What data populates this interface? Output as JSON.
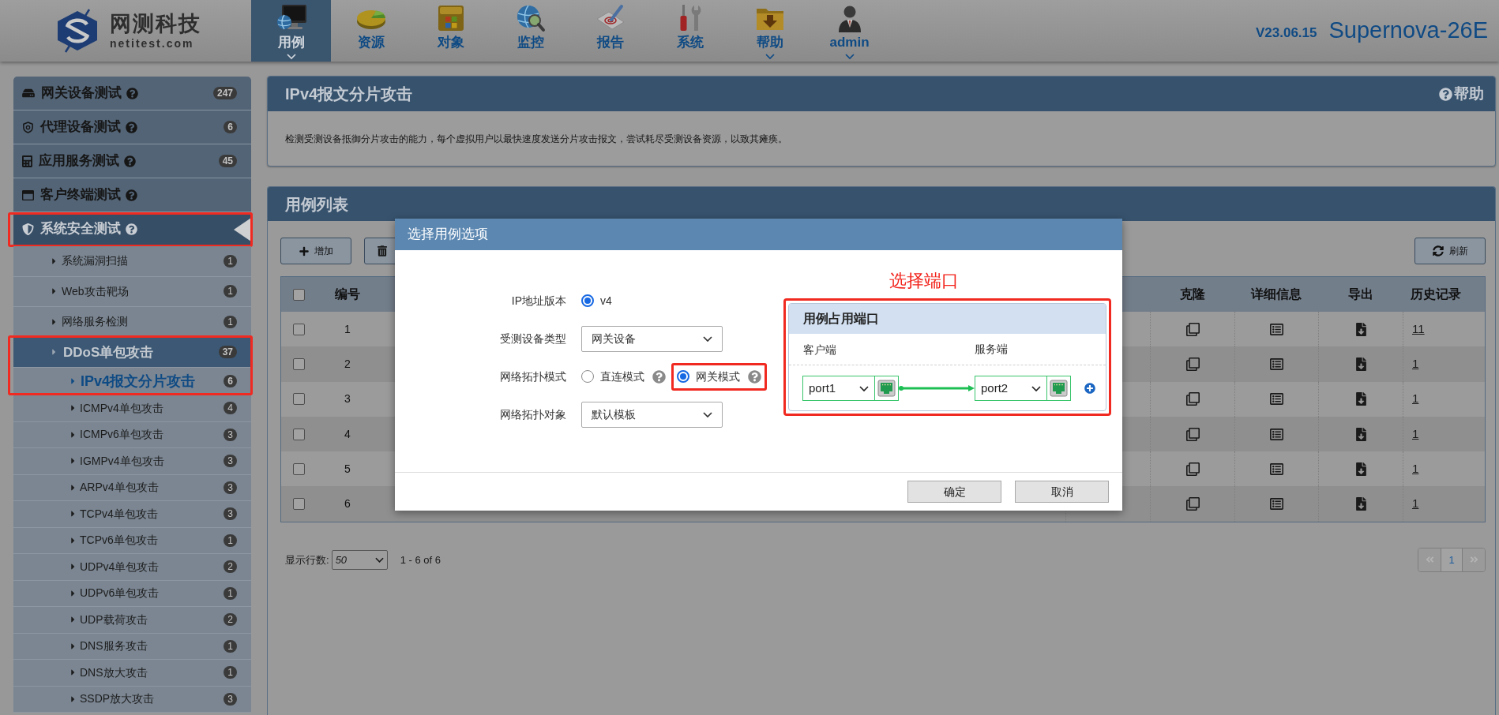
{
  "header": {
    "logo": {
      "name": "网测科技",
      "domain": "netitest.com"
    },
    "nav": [
      {
        "label": "用例",
        "selected": true,
        "dropdown": true
      },
      {
        "label": "资源",
        "selected": false,
        "dropdown": false
      },
      {
        "label": "对象",
        "selected": false,
        "dropdown": false
      },
      {
        "label": "监控",
        "selected": false,
        "dropdown": false
      },
      {
        "label": "报告",
        "selected": false,
        "dropdown": false
      },
      {
        "label": "系统",
        "selected": false,
        "dropdown": false
      },
      {
        "label": "帮助",
        "selected": false,
        "dropdown": true
      },
      {
        "label": "admin",
        "selected": false,
        "dropdown": true
      }
    ],
    "version": "V23.06.15",
    "product": "Supernova-26E"
  },
  "sidebar": {
    "items": [
      {
        "label": "网关设备测试",
        "count": "247",
        "selected": false,
        "highlighted": false
      },
      {
        "label": "代理设备测试",
        "count": "6",
        "selected": false,
        "highlighted": false
      },
      {
        "label": "应用服务测试",
        "count": "45",
        "selected": false,
        "highlighted": false
      },
      {
        "label": "客户终端测试",
        "selected": false,
        "highlighted": false
      },
      {
        "label": "系统安全测试",
        "selected": true,
        "highlighted": true,
        "children": [
          {
            "label": "系统漏洞扫描",
            "count": "1",
            "expanded": false,
            "highlighted": false
          },
          {
            "label": "Web攻击靶场",
            "count": "1",
            "expanded": false,
            "highlighted": false
          },
          {
            "label": "网络服务检测",
            "count": "1",
            "expanded": false,
            "highlighted": false
          },
          {
            "label": "DDoS单包攻击",
            "count": "37",
            "expanded": true,
            "highlighted": true,
            "children": [
              {
                "label": "IPv4报文分片攻击",
                "count": "6",
                "selected": true,
                "highlighted": true
              },
              {
                "label": "ICMPv4单包攻击",
                "count": "4",
                "selected": false,
                "highlighted": false
              },
              {
                "label": "ICMPv6单包攻击",
                "count": "3",
                "selected": false,
                "highlighted": false
              },
              {
                "label": "IGMPv4单包攻击",
                "count": "3",
                "selected": false,
                "highlighted": false
              },
              {
                "label": "ARPv4单包攻击",
                "count": "3",
                "selected": false,
                "highlighted": false
              },
              {
                "label": "TCPv4单包攻击",
                "count": "3",
                "selected": false,
                "highlighted": false
              },
              {
                "label": "TCPv6单包攻击",
                "count": "1",
                "selected": false,
                "highlighted": false
              },
              {
                "label": "UDPv4单包攻击",
                "count": "2",
                "selected": false,
                "highlighted": false
              },
              {
                "label": "UDPv6单包攻击",
                "count": "1",
                "selected": false,
                "highlighted": false
              },
              {
                "label": "UDP载荷攻击",
                "count": "2",
                "selected": false,
                "highlighted": false
              },
              {
                "label": "DNS服务攻击",
                "count": "1",
                "selected": false,
                "highlighted": false
              },
              {
                "label": "DNS放大攻击",
                "count": "1",
                "selected": false,
                "highlighted": false
              },
              {
                "label": "SSDP放大攻击",
                "count": "3",
                "selected": false,
                "highlighted": false
              }
            ]
          }
        ]
      }
    ]
  },
  "detail_panel": {
    "title": "IPv4报文分片攻击",
    "help": "帮助",
    "description": "检测受测设备抵御分片攻击的能力，每个虚拟用户以最快速度发送分片攻击报文，尝试耗尽受测设备资源，以致其瘫痪。"
  },
  "case_list": {
    "title": "用例列表",
    "add_button": "增加",
    "refresh_button": "刷新",
    "table": {
      "select_all": false,
      "columns": [
        {
          "label": "编号"
        },
        {
          "label": "克隆"
        },
        {
          "label": "详细信息"
        },
        {
          "label": "导出"
        },
        {
          "label": "历史记录"
        }
      ],
      "rows": [
        {
          "checked": false,
          "number": "1",
          "history": "11"
        },
        {
          "checked": false,
          "number": "2",
          "history": "1"
        },
        {
          "checked": false,
          "number": "3",
          "history": "1"
        },
        {
          "checked": false,
          "number": "4",
          "history": "1"
        },
        {
          "checked": false,
          "number": "5",
          "history": "1"
        },
        {
          "checked": false,
          "number": "6",
          "history": "1"
        }
      ]
    },
    "page_size": {
      "label": "显示行数:",
      "value": "50"
    },
    "range": "1 - 6 of 6",
    "pages": [
      {
        "label": "1",
        "selected": true
      }
    ]
  },
  "dialog": {
    "title": "选择用例选项",
    "fields": [
      {
        "kind": "radio",
        "label": "IP地址版本",
        "options": [
          {
            "label": "v4",
            "selected": true,
            "help": false,
            "highlighted": false
          }
        ]
      },
      {
        "kind": "select",
        "label": "受测设备类型",
        "value": "网关设备"
      },
      {
        "kind": "radio",
        "label": "网络拓扑模式",
        "options": [
          {
            "label": "直连模式",
            "selected": false,
            "help": true,
            "highlighted": false
          },
          {
            "label": "网关模式",
            "selected": true,
            "help": true,
            "highlighted": true
          }
        ]
      },
      {
        "kind": "select",
        "label": "网络拓扑对象",
        "value": "默认模板"
      }
    ],
    "port_panel": {
      "annotation": "选择端口",
      "highlighted": true,
      "title": "用例占用端口",
      "client_label": "客户端",
      "server_label": "服务端",
      "client_port": "port1",
      "server_port": "port2"
    },
    "buttons": [
      {
        "label": "确定"
      },
      {
        "label": "取消"
      }
    ]
  }
}
